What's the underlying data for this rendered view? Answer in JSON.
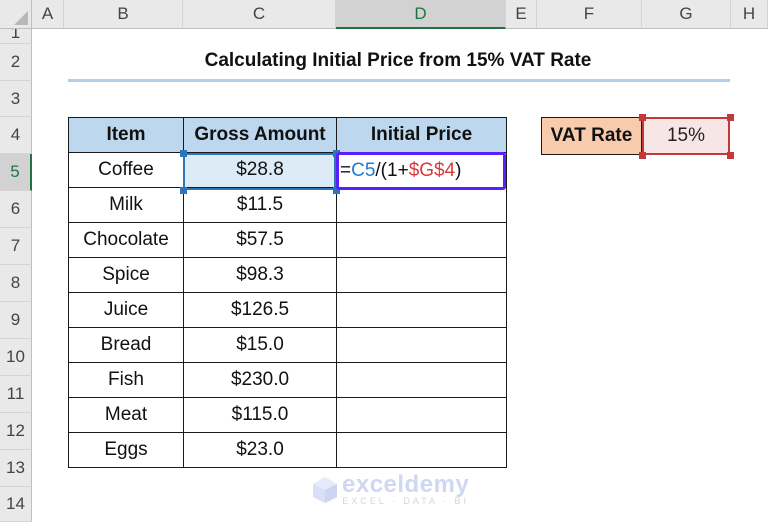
{
  "spreadsheet": {
    "columns": [
      "A",
      "B",
      "C",
      "D",
      "E",
      "F",
      "G",
      "H"
    ],
    "active_column": "D",
    "rows": [
      "1",
      "2",
      "3",
      "4",
      "5",
      "6",
      "7",
      "8",
      "9",
      "10",
      "11",
      "12",
      "13",
      "14"
    ],
    "active_row": "5"
  },
  "title": "Calculating Initial Price from 15% VAT Rate",
  "table": {
    "headers": [
      "Item",
      "Gross Amount",
      "Initial Price"
    ],
    "rows": [
      {
        "item": "Coffee",
        "gross": "$28.8",
        "initial": ""
      },
      {
        "item": "Milk",
        "gross": "$11.5",
        "initial": ""
      },
      {
        "item": "Chocolate",
        "gross": "$57.5",
        "initial": ""
      },
      {
        "item": "Spice",
        "gross": "$98.3",
        "initial": ""
      },
      {
        "item": "Juice",
        "gross": "$126.5",
        "initial": ""
      },
      {
        "item": "Bread",
        "gross": "$15.0",
        "initial": ""
      },
      {
        "item": "Fish",
        "gross": "$230.0",
        "initial": ""
      },
      {
        "item": "Meat",
        "gross": "$115.0",
        "initial": ""
      },
      {
        "item": "Eggs",
        "gross": "$23.0",
        "initial": ""
      }
    ]
  },
  "formula": {
    "cell": "D5",
    "eq": "=",
    "ref1": "C5",
    "mid": "/(1+",
    "ref2": "$G$4",
    "end": ")"
  },
  "vat": {
    "label": "VAT Rate",
    "value": "15%"
  },
  "watermark": {
    "brand": "exceldemy",
    "tagline": "EXCEL · DATA · BI"
  },
  "colors": {
    "header_fill": "#bdd7ee",
    "vat_label_fill": "#f8cbad",
    "edit_border": "#5b1fff",
    "ref_blue": "#1f7bd6",
    "ref_red": "#d9393b"
  }
}
